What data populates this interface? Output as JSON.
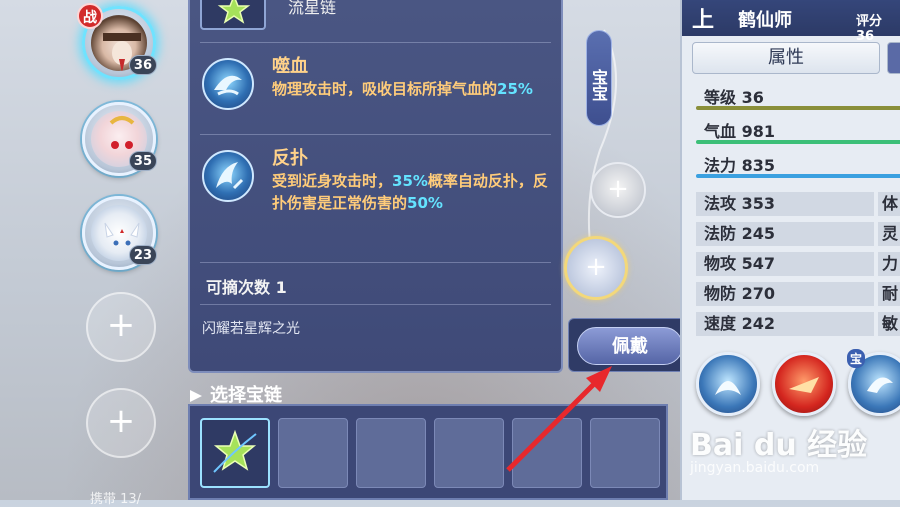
{
  "team": {
    "pets": [
      {
        "level": "36",
        "battle_tag": "战",
        "active": true
      },
      {
        "level": "35"
      },
      {
        "level": "23"
      }
    ],
    "empty_slot_symbol": "+",
    "bottom_label": "携带 13/"
  },
  "skill_panel": {
    "item_name": "流星链",
    "skills": [
      {
        "name": "噬血",
        "desc_parts": [
          "物理攻击时，吸收目标所掉气血的",
          "25%"
        ],
        "icon": "blood-drain-icon"
      },
      {
        "name": "反扑",
        "desc_parts": [
          "受到近身攻击时，",
          "35%",
          "概率自动反扑，反扑伤害是正常伤害的",
          "50%"
        ],
        "icon": "counter-attack-icon"
      }
    ],
    "remove_count_label": "可摘次数",
    "remove_count_value": "1",
    "flavor_text": "闪耀若星辉之光",
    "highlight_color": "#64e3ff",
    "desc_color": "#ffcc7a"
  },
  "track": {
    "tag_label": "宝宝",
    "node_symbol": "+"
  },
  "equip_button": {
    "label": "佩戴"
  },
  "chain_select": {
    "header": "选择宝链",
    "cells": [
      {
        "selected": true,
        "icon": "star-chain-icon"
      },
      {
        "selected": false
      },
      {
        "selected": false
      },
      {
        "selected": false
      },
      {
        "selected": false
      },
      {
        "selected": false
      }
    ]
  },
  "attributes": {
    "up_mark": "上",
    "hero_name": "鹤仙师",
    "score_label": "评分 36",
    "tab_label": "属性",
    "bars": [
      {
        "label": "等级",
        "value": "36",
        "color": "#8a8f3a"
      },
      {
        "label": "气血",
        "value": "981",
        "color": "#3cbf78"
      },
      {
        "label": "法力",
        "value": "835",
        "color": "#3aa0e0"
      }
    ],
    "grid": [
      {
        "left": {
          "label": "法攻",
          "value": "353"
        },
        "right": "体"
      },
      {
        "left": {
          "label": "法防",
          "value": "245"
        },
        "right": "灵"
      },
      {
        "left": {
          "label": "物攻",
          "value": "547"
        },
        "right": "力"
      },
      {
        "left": {
          "label": "物防",
          "value": "270"
        },
        "right": "耐"
      },
      {
        "left": {
          "label": "速度",
          "value": "242"
        },
        "right": "敏"
      }
    ],
    "skill_orbs": [
      "pet-skill-icon",
      "fire-skill-icon",
      "treasure-skill-icon"
    ],
    "orb_tag": "宝"
  },
  "watermark": {
    "brand": "Bai du 经验",
    "url": "jingyan.baidu.com"
  },
  "colors": {
    "panel_bg": "#3f4a78",
    "arrow": "#e8282c",
    "accent_cyan": "#6fe3ff"
  }
}
